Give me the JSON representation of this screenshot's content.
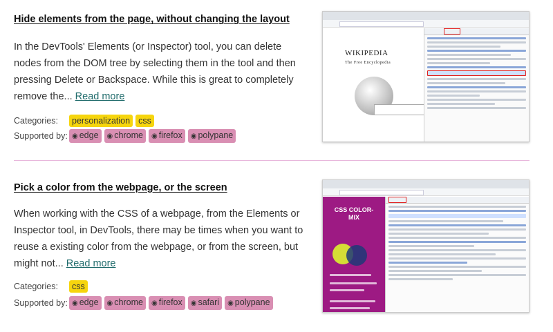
{
  "articles": [
    {
      "title": "Hide elements from the page, without changing the layout",
      "description": "In the DevTools' Elements (or Inspector) tool, you can delete nodes from the DOM tree by selecting them in the tool and then pressing Delete or Backspace. While this is great to completely remove the...",
      "read_more": "Read more",
      "categories_label": "Categories:",
      "categories": [
        "personalization",
        "css"
      ],
      "supported_label": "Supported by:",
      "browsers": [
        "edge",
        "chrome",
        "firefox",
        "polypane"
      ],
      "screenshot": {
        "brand": "WIKIPEDIA",
        "subtitle": "The Free Encyclopedia"
      }
    },
    {
      "title": "Pick a color from the webpage, or the screen",
      "description": "When working with the CSS of a webpage, from the Elements or Inspector tool, in DevTools, there may be times when you want to reuse a existing color from the webpage, or from the screen, but might not...",
      "read_more": "Read more",
      "categories_label": "Categories:",
      "categories": [
        "css"
      ],
      "supported_label": "Supported by:",
      "browsers": [
        "edge",
        "chrome",
        "firefox",
        "safari",
        "polypane"
      ],
      "screenshot": {
        "brand": "CSS COLOR-MIX"
      }
    }
  ],
  "colors": {
    "category_bg": "#f6d50e",
    "browser_bg": "#d98fb3",
    "divider": "#e8b7dc",
    "link": "#1f6b6b"
  }
}
